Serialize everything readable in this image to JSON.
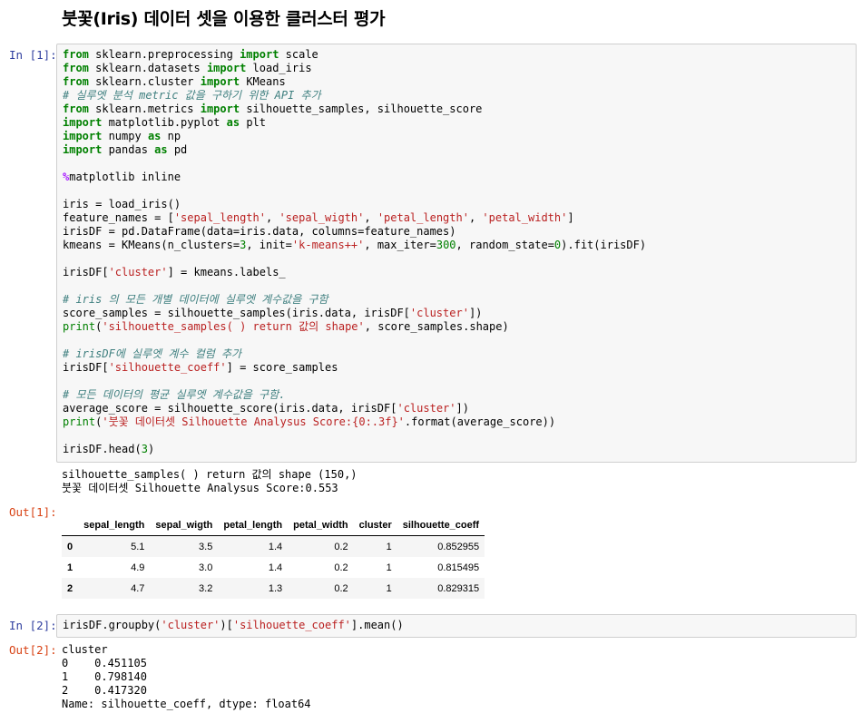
{
  "heading": "붓꽃(Iris) 데이터 셋을 이용한 클러스터 평가",
  "cell1": {
    "prompt": "In [1]:",
    "lines": [
      [
        [
          "kw",
          "from"
        ],
        [
          "t",
          " sklearn.preprocessing "
        ],
        [
          "kw",
          "import"
        ],
        [
          "t",
          " scale"
        ]
      ],
      [
        [
          "kw",
          "from"
        ],
        [
          "t",
          " sklearn.datasets "
        ],
        [
          "kw",
          "import"
        ],
        [
          "t",
          " load_iris"
        ]
      ],
      [
        [
          "kw",
          "from"
        ],
        [
          "t",
          " sklearn.cluster "
        ],
        [
          "kw",
          "import"
        ],
        [
          "t",
          " KMeans"
        ]
      ],
      [
        [
          "cm",
          "# 실루엣 분석 metric 값을 구하기 위한 API 추가"
        ]
      ],
      [
        [
          "kw",
          "from"
        ],
        [
          "t",
          " sklearn.metrics "
        ],
        [
          "kw",
          "import"
        ],
        [
          "t",
          " silhouette_samples, silhouette_score"
        ]
      ],
      [
        [
          "kw",
          "import"
        ],
        [
          "t",
          " matplotlib.pyplot "
        ],
        [
          "kw",
          "as"
        ],
        [
          "t",
          " plt"
        ]
      ],
      [
        [
          "kw",
          "import"
        ],
        [
          "t",
          " numpy "
        ],
        [
          "kw",
          "as"
        ],
        [
          "t",
          " np"
        ]
      ],
      [
        [
          "kw",
          "import"
        ],
        [
          "t",
          " pandas "
        ],
        [
          "kw",
          "as"
        ],
        [
          "t",
          " pd"
        ]
      ],
      [],
      [
        [
          "mg",
          "%"
        ],
        [
          "t",
          "matplotlib inline"
        ]
      ],
      [],
      [
        [
          "t",
          "iris = load_iris()"
        ]
      ],
      [
        [
          "t",
          "feature_names = ["
        ],
        [
          "st",
          "'sepal_length'"
        ],
        [
          "t",
          ", "
        ],
        [
          "st",
          "'sepal_wigth'"
        ],
        [
          "t",
          ", "
        ],
        [
          "st",
          "'petal_length'"
        ],
        [
          "t",
          ", "
        ],
        [
          "st",
          "'petal_width'"
        ],
        [
          "t",
          "]"
        ]
      ],
      [
        [
          "t",
          "irisDF = pd.DataFrame(data=iris.data, columns=feature_names)"
        ]
      ],
      [
        [
          "t",
          "kmeans = KMeans(n_clusters="
        ],
        [
          "nm",
          "3"
        ],
        [
          "t",
          ", init="
        ],
        [
          "st",
          "'k-means++'"
        ],
        [
          "t",
          ", max_iter="
        ],
        [
          "nm",
          "300"
        ],
        [
          "t",
          ", random_state="
        ],
        [
          "nm",
          "0"
        ],
        [
          "t",
          ").fit(irisDF)"
        ]
      ],
      [],
      [
        [
          "t",
          "irisDF["
        ],
        [
          "st",
          "'cluster'"
        ],
        [
          "t",
          "] = kmeans.labels_"
        ]
      ],
      [],
      [
        [
          "cm",
          "# iris 의 모든 개별 데이터에 실루엣 계수값을 구함"
        ]
      ],
      [
        [
          "t",
          "score_samples = silhouette_samples(iris.data, irisDF["
        ],
        [
          "st",
          "'cluster'"
        ],
        [
          "t",
          "])"
        ]
      ],
      [
        [
          "nm",
          "print"
        ],
        [
          "t",
          "("
        ],
        [
          "st",
          "'silhouette_samples( ) return 값의 shape'"
        ],
        [
          "t",
          ", score_samples.shape)"
        ]
      ],
      [],
      [
        [
          "cm",
          "# irisDF에 실루엣 계수 컬럼 추가"
        ]
      ],
      [
        [
          "t",
          "irisDF["
        ],
        [
          "st",
          "'silhouette_coeff'"
        ],
        [
          "t",
          "] = score_samples"
        ]
      ],
      [],
      [
        [
          "cm",
          "# 모든 데이터의 평균 실루엣 계수값을 구함."
        ]
      ],
      [
        [
          "t",
          "average_score = silhouette_score(iris.data, irisDF["
        ],
        [
          "st",
          "'cluster'"
        ],
        [
          "t",
          "])"
        ]
      ],
      [
        [
          "nm",
          "print"
        ],
        [
          "t",
          "("
        ],
        [
          "st",
          "'붓꽃 데이터셋 Silhouette Analysus Score:{0:.3f}'"
        ],
        [
          "t",
          ".format(average_score))"
        ]
      ],
      [],
      [
        [
          "t",
          "irisDF.head("
        ],
        [
          "nm",
          "3"
        ],
        [
          "t",
          ")"
        ]
      ]
    ],
    "stdout": [
      "silhouette_samples( ) return 값의 shape (150,)",
      "붓꽃 데이터셋 Silhouette Analysus Score:0.553"
    ],
    "out_prompt": "Out[1]:",
    "table": {
      "columns": [
        "sepal_length",
        "sepal_wigth",
        "petal_length",
        "petal_width",
        "cluster",
        "silhouette_coeff"
      ],
      "rows": [
        {
          "index": "0",
          "cells": [
            "5.1",
            "3.5",
            "1.4",
            "0.2",
            "1",
            "0.852955"
          ]
        },
        {
          "index": "1",
          "cells": [
            "4.9",
            "3.0",
            "1.4",
            "0.2",
            "1",
            "0.815495"
          ]
        },
        {
          "index": "2",
          "cells": [
            "4.7",
            "3.2",
            "1.3",
            "0.2",
            "1",
            "0.829315"
          ]
        }
      ]
    }
  },
  "cell2": {
    "prompt": "In [2]:",
    "lines": [
      [
        [
          "t",
          "irisDF.groupby("
        ],
        [
          "st",
          "'cluster'"
        ],
        [
          "t",
          ")["
        ],
        [
          "st",
          "'silhouette_coeff'"
        ],
        [
          "t",
          "].mean()"
        ]
      ]
    ],
    "out_prompt": "Out[2]:",
    "output": [
      "cluster",
      "0    0.451105",
      "1    0.798140",
      "2    0.417320",
      "Name: silhouette_coeff, dtype: float64"
    ]
  }
}
